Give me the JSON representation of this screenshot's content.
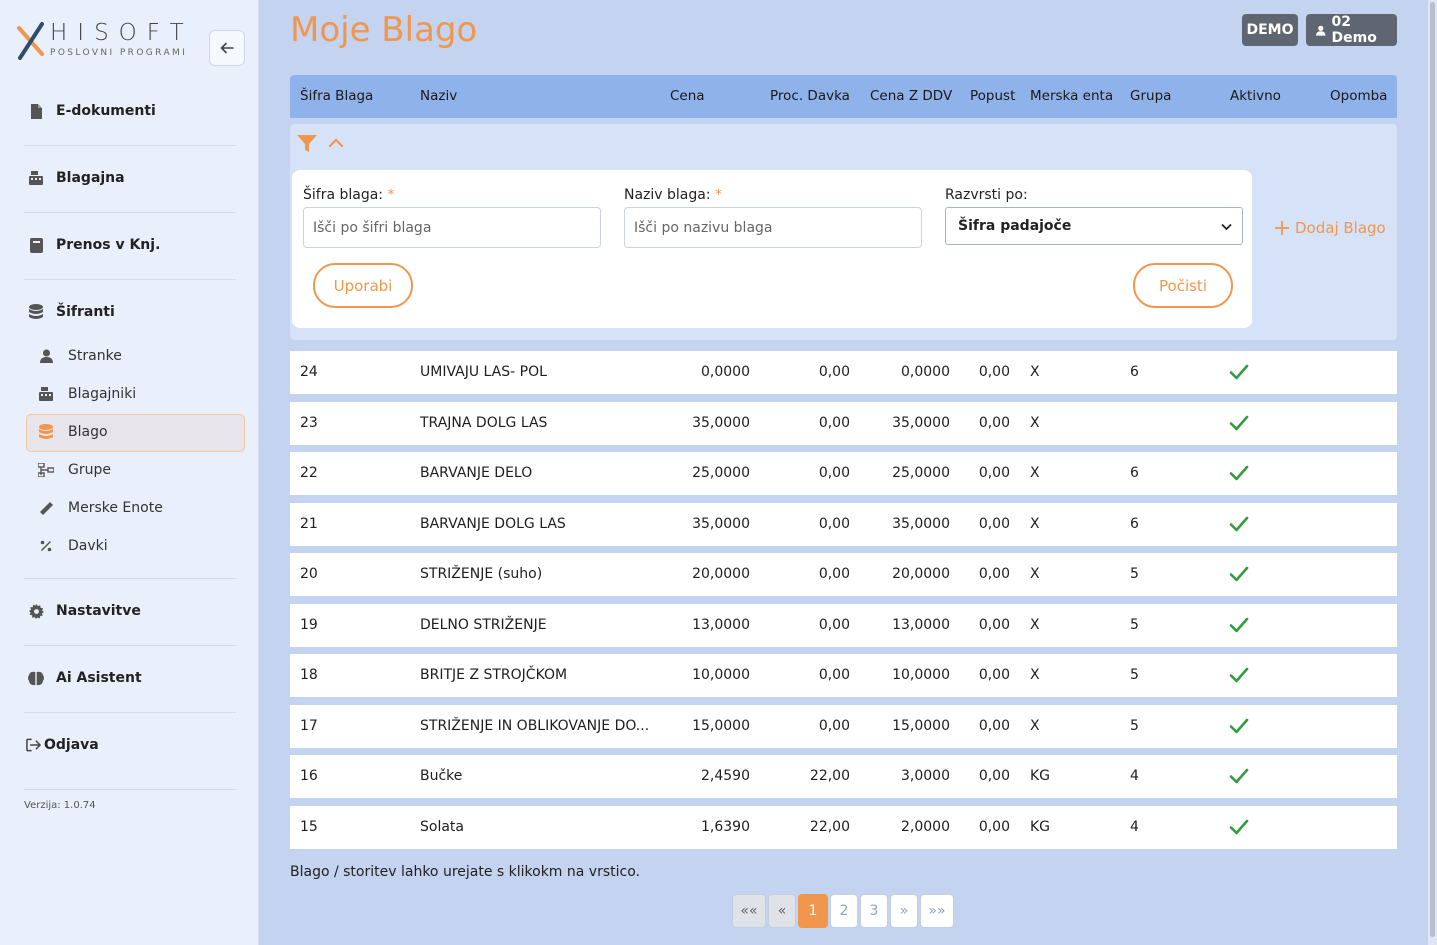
{
  "brand": {
    "name": "HISOFT",
    "tagline": "POSLOVNI PROGRAMI"
  },
  "sidebar": {
    "back_icon": "arrow-left-icon",
    "items": [
      {
        "label": "E-dokumenti",
        "icon": "document-icon"
      },
      {
        "label": "Blagajna",
        "icon": "cash-register-icon"
      },
      {
        "label": "Prenos v Knj.",
        "icon": "book-icon"
      },
      {
        "label": "Šifranti",
        "icon": "database-icon"
      },
      {
        "label": "Nastavitve",
        "icon": "gear-icon"
      },
      {
        "label": "Ai Asistent",
        "icon": "brain-icon"
      },
      {
        "label": "Odjava",
        "icon": "logout-icon"
      }
    ],
    "subitems": [
      {
        "label": "Stranke",
        "icon": "user-icon"
      },
      {
        "label": "Blagajniki",
        "icon": "cash-register-icon"
      },
      {
        "label": "Blago",
        "icon": "database-icon",
        "active": true
      },
      {
        "label": "Grupe",
        "icon": "sitemap-icon"
      },
      {
        "label": "Merske Enote",
        "icon": "ruler-icon"
      },
      {
        "label": "Davki",
        "icon": "percent-icon"
      }
    ],
    "version": "Verzija: 1.0.74"
  },
  "header": {
    "title": "Moje Blago",
    "demo_label": "DEMO",
    "user_label": "02 Demo"
  },
  "table": {
    "columns": [
      "Šifra Blaga",
      "Naziv",
      "Cena",
      "Proc. Davka",
      "Cena Z DDV",
      "Popust",
      "Merska enta",
      "Grupa",
      "Aktivno",
      "Opomba"
    ],
    "rows": [
      {
        "sifra": "24",
        "naziv": "UMIVAJU LAS- POL",
        "cena": "0,0000",
        "davek": "0,00",
        "cena_ddv": "0,0000",
        "popust": "0,00",
        "enota": "X",
        "grupa": "6",
        "aktivno": true,
        "opomba": ""
      },
      {
        "sifra": "23",
        "naziv": "TRAJNA DOLG LAS",
        "cena": "35,0000",
        "davek": "0,00",
        "cena_ddv": "35,0000",
        "popust": "0,00",
        "enota": "X",
        "grupa": "",
        "aktivno": true,
        "opomba": ""
      },
      {
        "sifra": "22",
        "naziv": "BARVANJE DELO",
        "cena": "25,0000",
        "davek": "0,00",
        "cena_ddv": "25,0000",
        "popust": "0,00",
        "enota": "X",
        "grupa": "6",
        "aktivno": true,
        "opomba": ""
      },
      {
        "sifra": "21",
        "naziv": "BARVANJE DOLG LAS",
        "cena": "35,0000",
        "davek": "0,00",
        "cena_ddv": "35,0000",
        "popust": "0,00",
        "enota": "X",
        "grupa": "6",
        "aktivno": true,
        "opomba": ""
      },
      {
        "sifra": "20",
        "naziv": "STRIŽENJE (suho)",
        "cena": "20,0000",
        "davek": "0,00",
        "cena_ddv": "20,0000",
        "popust": "0,00",
        "enota": "X",
        "grupa": "5",
        "aktivno": true,
        "opomba": ""
      },
      {
        "sifra": "19",
        "naziv": "DELNO STRIŽENJE",
        "cena": "13,0000",
        "davek": "0,00",
        "cena_ddv": "13,0000",
        "popust": "0,00",
        "enota": "X",
        "grupa": "5",
        "aktivno": true,
        "opomba": ""
      },
      {
        "sifra": "18",
        "naziv": "BRITJE Z STROJČKOM",
        "cena": "10,0000",
        "davek": "0,00",
        "cena_ddv": "10,0000",
        "popust": "0,00",
        "enota": "X",
        "grupa": "5",
        "aktivno": true,
        "opomba": ""
      },
      {
        "sifra": "17",
        "naziv": "STRIŽENJE IN OBLIKOVANJE DO...",
        "cena": "15,0000",
        "davek": "0,00",
        "cena_ddv": "15,0000",
        "popust": "0,00",
        "enota": "X",
        "grupa": "5",
        "aktivno": true,
        "opomba": ""
      },
      {
        "sifra": "16",
        "naziv": "Bučke",
        "cena": "2,4590",
        "davek": "22,00",
        "cena_ddv": "3,0000",
        "popust": "0,00",
        "enota": "KG",
        "grupa": "4",
        "aktivno": true,
        "opomba": ""
      },
      {
        "sifra": "15",
        "naziv": "Solata",
        "cena": "1,6390",
        "davek": "22,00",
        "cena_ddv": "2,0000",
        "popust": "0,00",
        "enota": "KG",
        "grupa": "4",
        "aktivno": true,
        "opomba": ""
      }
    ]
  },
  "filter": {
    "icon": "filter-icon",
    "collapse_icon": "chevron-up-icon",
    "sifra_label": "Šifra blaga:",
    "sifra_placeholder": "Išči po šifri blaga",
    "naziv_label": "Naziv blaga:",
    "naziv_placeholder": "Išči po nazivu blaga",
    "required_mark": "*",
    "sort_label": "Razvrsti po:",
    "sort_value": "Šifra padajoče",
    "apply_label": "Uporabi",
    "clear_label": "Počisti",
    "add_label": "Dodaj Blago"
  },
  "footnote": "Blago / storitev lahko urejate s klikokm na vrstico.",
  "pagination": {
    "first": "««",
    "prev": "«",
    "pages": [
      "1",
      "2",
      "3"
    ],
    "current": "1",
    "next": "»",
    "last": "»»"
  },
  "colors": {
    "accent": "#f0974d",
    "header_bg": "#8fb2ea",
    "check": "#2e9e3e",
    "page_bg": "#c3d3f0"
  }
}
